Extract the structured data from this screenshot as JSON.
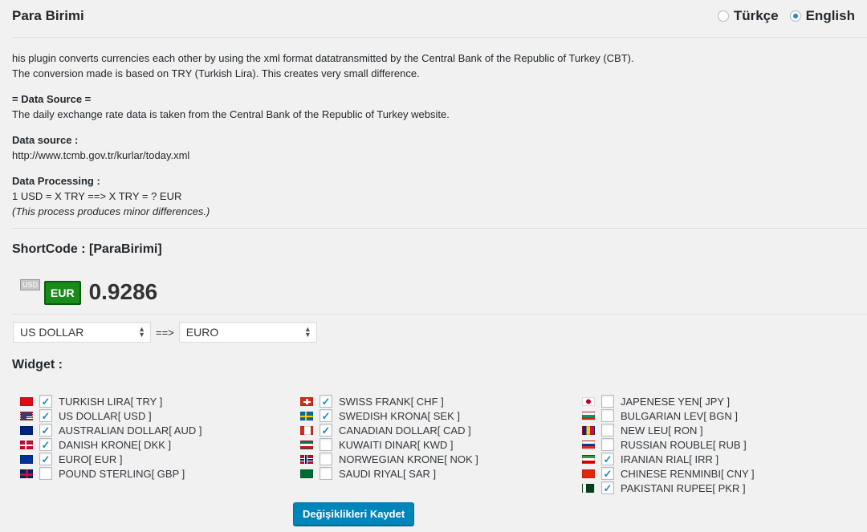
{
  "title": "Para Birimi",
  "language": {
    "options": [
      {
        "label": "Türkçe",
        "selected": false
      },
      {
        "label": "English",
        "selected": true
      }
    ]
  },
  "description": {
    "line1": "his plugin converts currencies each other by using the xml format datatransmitted by the Central Bank of the Republic of Turkey (CBT).",
    "line2": "The conversion made is based on TRY (Turkish Lira). This creates very small difference.",
    "data_source_heading": "= Data Source =",
    "data_source_text": "The daily exchange rate data is taken from the Central Bank of the Republic of Turkey website.",
    "data_source_label": "Data source :",
    "data_source_url": "http://www.tcmb.gov.tr/kurlar/today.xml",
    "processing_label": "Data Processing :",
    "processing_formula": "1 USD = X TRY ==> X TRY = ? EUR",
    "processing_note": "(This process produces minor differences.)"
  },
  "shortcode": "ShortCode : [ParaBirimi]",
  "rate": {
    "from": "USD",
    "to": "EUR",
    "value": "0.9286"
  },
  "converter": {
    "from": "US DOLLAR",
    "arrow": "==>",
    "to": "EURO"
  },
  "widget_label": "Widget :",
  "currencies": {
    "col1": [
      {
        "name": "TURKISH LIRA[ TRY ]",
        "checked": true,
        "flag": "tr"
      },
      {
        "name": "US DOLLAR[ USD ]",
        "checked": true,
        "flag": "us"
      },
      {
        "name": "AUSTRALIAN DOLLAR[ AUD ]",
        "checked": true,
        "flag": "au"
      },
      {
        "name": "DANISH KRONE[ DKK ]",
        "checked": true,
        "flag": "dk"
      },
      {
        "name": "EURO[ EUR ]",
        "checked": true,
        "flag": "eu"
      },
      {
        "name": "POUND STERLING[ GBP ]",
        "checked": false,
        "flag": "gb"
      }
    ],
    "col2": [
      {
        "name": "SWISS FRANK[ CHF ]",
        "checked": true,
        "flag": "ch"
      },
      {
        "name": "SWEDISH KRONA[ SEK ]",
        "checked": true,
        "flag": "se"
      },
      {
        "name": "CANADIAN DOLLAR[ CAD ]",
        "checked": true,
        "flag": "ca"
      },
      {
        "name": "KUWAITI DINAR[ KWD ]",
        "checked": false,
        "flag": "kw"
      },
      {
        "name": "NORWEGIAN KRONE[ NOK ]",
        "checked": false,
        "flag": "no"
      },
      {
        "name": "SAUDI RIYAL[ SAR ]",
        "checked": false,
        "flag": "sa"
      }
    ],
    "col3": [
      {
        "name": "JAPENESE YEN[ JPY ]",
        "checked": false,
        "flag": "jp"
      },
      {
        "name": "BULGARIAN LEV[ BGN ]",
        "checked": false,
        "flag": "bg"
      },
      {
        "name": "NEW LEU[ RON ]",
        "checked": false,
        "flag": "ro"
      },
      {
        "name": "RUSSIAN ROUBLE[ RUB ]",
        "checked": false,
        "flag": "ru"
      },
      {
        "name": "IRANIAN RIAL[ IRR ]",
        "checked": true,
        "flag": "ir"
      },
      {
        "name": "CHINESE RENMINBI[ CNY ]",
        "checked": true,
        "flag": "cn"
      },
      {
        "name": "PAKISTANI RUPEE[ PKR ]",
        "checked": true,
        "flag": "pk"
      }
    ]
  },
  "save_button": "Değişiklikleri Kaydet"
}
